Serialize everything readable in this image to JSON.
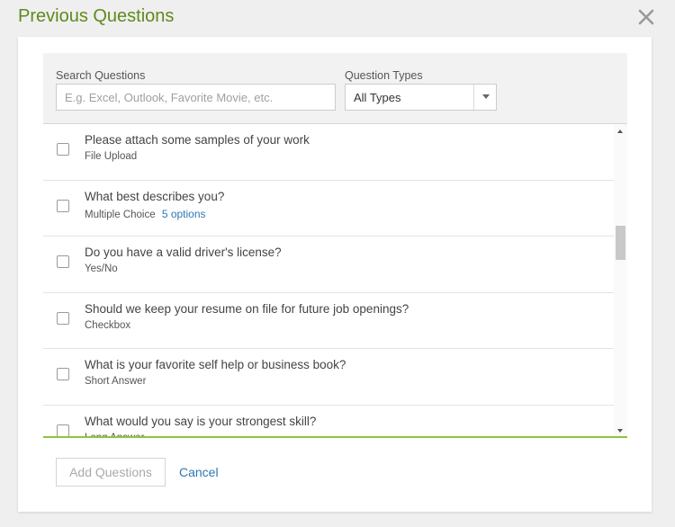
{
  "dialog": {
    "title": "Previous Questions"
  },
  "filters": {
    "search_label": "Search Questions",
    "search_placeholder": "E.g. Excel, Outlook, Favorite Movie, etc.",
    "search_value": "",
    "type_label": "Question Types",
    "type_value": "All Types"
  },
  "questions": [
    {
      "text": "Please attach some samples of your work",
      "type": "File Upload",
      "options": "",
      "checked": false
    },
    {
      "text": "What best describes you?",
      "type": "Multiple Choice",
      "options": "5 options",
      "checked": false
    },
    {
      "text": "Do you have a valid driver's license?",
      "type": "Yes/No",
      "options": "",
      "checked": false
    },
    {
      "text": "Should we keep your resume on file for future job openings?",
      "type": "Checkbox",
      "options": "",
      "checked": false
    },
    {
      "text": "What is your favorite self help or business book?",
      "type": "Short Answer",
      "options": "",
      "checked": false
    },
    {
      "text": "What would you say is your strongest skill?",
      "type": "Long Answer",
      "options": "",
      "checked": false
    }
  ],
  "footer": {
    "add_label": "Add Questions",
    "cancel_label": "Cancel"
  },
  "icons": {
    "close": "close-icon",
    "dropdown": "chevron-down-icon"
  },
  "colors": {
    "title": "#5f8a1c",
    "accent_line": "#8cc63f",
    "link": "#2d78b4",
    "filter_bg": "#f2f2f2",
    "page_bg": "#efefef"
  }
}
